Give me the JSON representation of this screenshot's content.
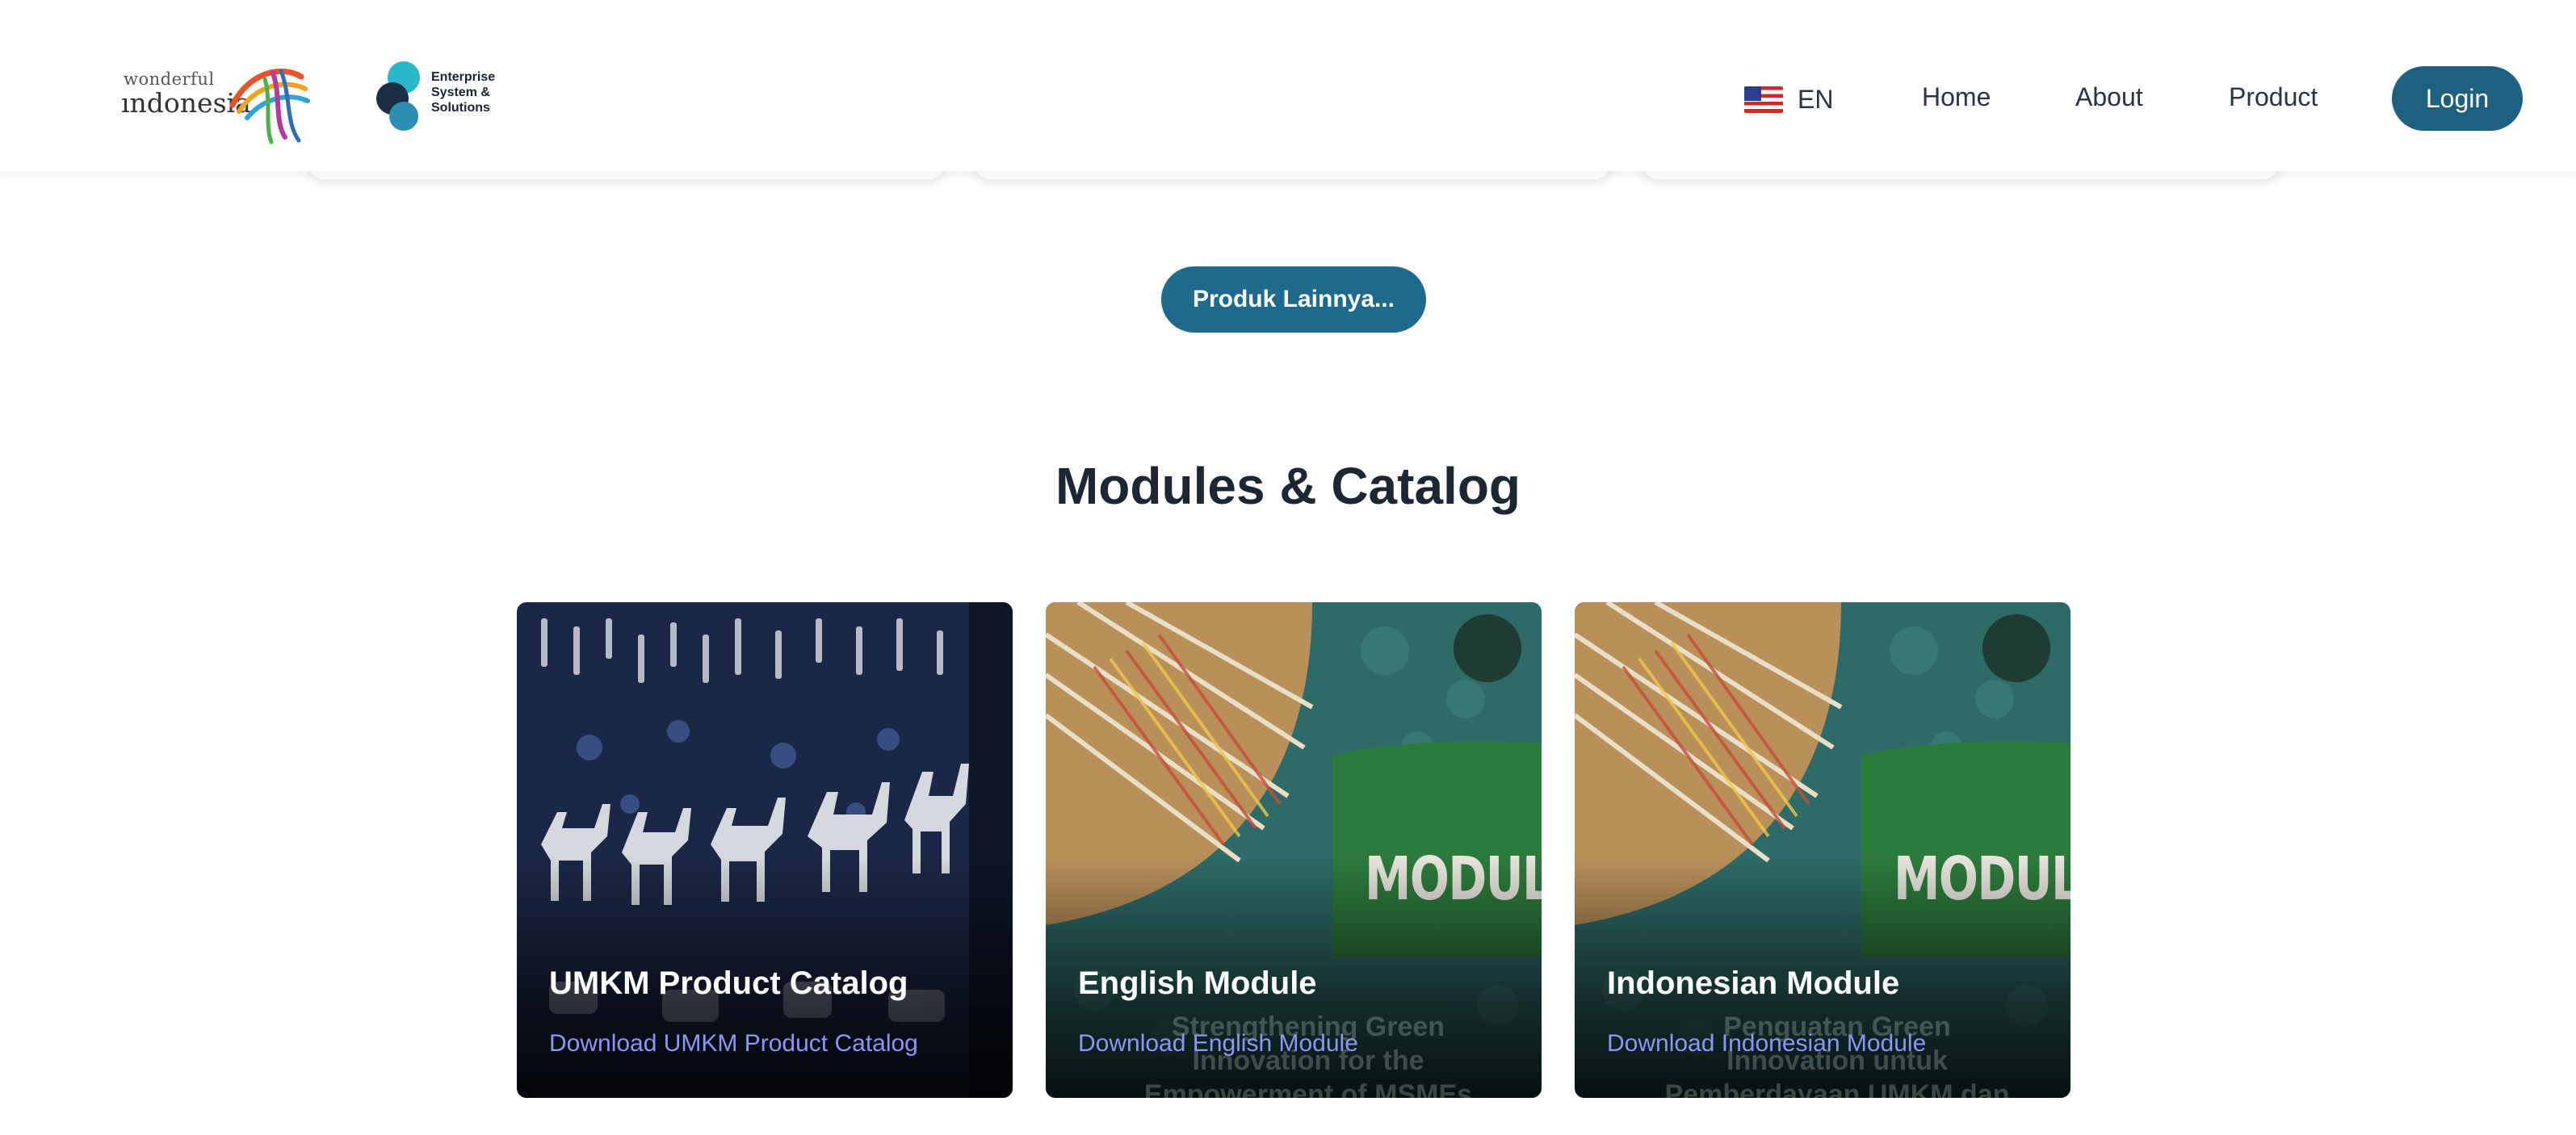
{
  "header": {
    "brand_logo": {
      "line1": "wonderful",
      "line2": "ındonesia"
    },
    "partner_logo": {
      "lines": [
        "Enterprise",
        "System &",
        "Solutions"
      ]
    },
    "language": {
      "code": "EN",
      "flag_icon": "us-flag-icon"
    },
    "nav": {
      "home": "Home",
      "about": "About",
      "product": "Product"
    },
    "login_label": "Login"
  },
  "more_products_label": "Produk Lainnya...",
  "section_title": "Modules & Catalog",
  "cards": [
    {
      "title": "UMKM Product Catalog",
      "link": "Download UMKM Product Catalog"
    },
    {
      "title": "English Module",
      "link": "Download English Module",
      "cover_word": "MODUL",
      "cover_subtitle": "Strengthening Green Innovation for the Empowerment of MSMEs"
    },
    {
      "title": "Indonesian Module",
      "link": "Download Indonesian Module",
      "cover_word": "MODUL",
      "cover_subtitle": "Penguatan Green Innovation untuk Pemberdayaan UMKM dan Ekonomi Desa"
    }
  ],
  "colors": {
    "primary": "#1f6a8c",
    "login": "#1f5f80",
    "link": "#8f95f4",
    "title": "#1d2633"
  }
}
